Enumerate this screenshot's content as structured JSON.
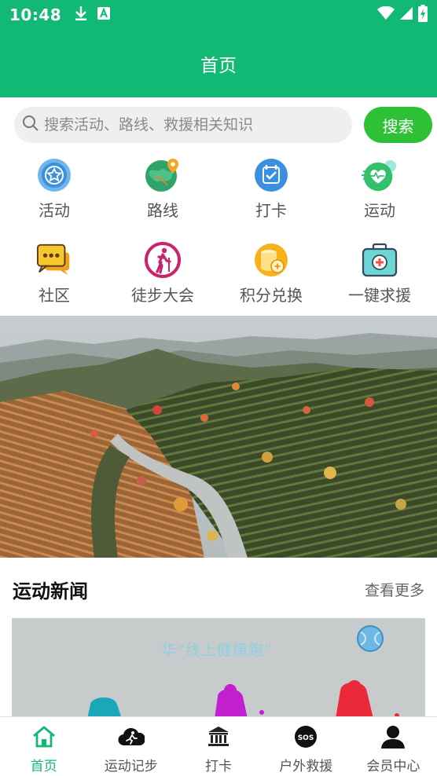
{
  "status_bar": {
    "time": "10:48",
    "left_icons": [
      "download-icon",
      "a-icon"
    ],
    "right_icons": [
      "wifi-icon",
      "signal-icon",
      "battery-charging-icon"
    ]
  },
  "app_bar": {
    "title": "首页"
  },
  "search": {
    "placeholder": "搜索活动、路线、救援相关知识",
    "value": "",
    "button_label": "搜索"
  },
  "quick_grid": [
    {
      "label": "活动",
      "icon": "star-badge-icon"
    },
    {
      "label": "路线",
      "icon": "map-globe-icon"
    },
    {
      "label": "打卡",
      "icon": "calendar-check-icon"
    },
    {
      "label": "运动",
      "icon": "heart-rate-icon"
    },
    {
      "label": "社区",
      "icon": "chat-bubbles-icon"
    },
    {
      "label": "徒步大会",
      "icon": "hiker-icon"
    },
    {
      "label": "积分兑换",
      "icon": "coins-icon"
    },
    {
      "label": "一键求援",
      "icon": "first-aid-kit-icon"
    }
  ],
  "banner": {
    "icon": "tea-terrace-landscape-photo"
  },
  "news": {
    "title": "运动新闻",
    "more_label": "查看更多",
    "first_caption": "华“线上健康跑”"
  },
  "tab_bar": {
    "active_color": "#12b975",
    "items": [
      {
        "label": "首页",
        "icon": "home-icon",
        "active": true
      },
      {
        "label": "运动记步",
        "icon": "running-cloud-icon",
        "active": false
      },
      {
        "label": "打卡",
        "icon": "landmark-icon",
        "active": false
      },
      {
        "label": "户外救援",
        "icon": "sos-icon",
        "active": false
      },
      {
        "label": "会员中心",
        "icon": "user-icon",
        "active": false
      }
    ]
  },
  "colors": {
    "primary": "#12b975",
    "search_button": "#2ec136"
  }
}
